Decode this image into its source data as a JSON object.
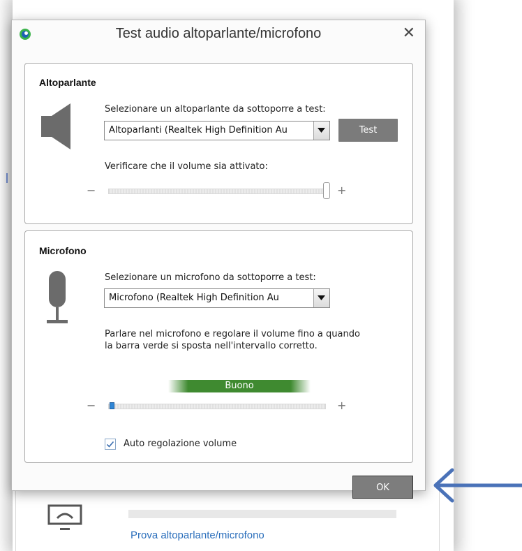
{
  "dialog": {
    "title": "Test audio altoparlante/microfono",
    "close_glyph": "✕",
    "ok_label": "OK"
  },
  "speaker": {
    "group_title": "Altoparlante",
    "select_prompt": "Selezionare un altoparlante da sottoporre a test:",
    "selected_device": "Altoparlanti (Realtek High Definition Au",
    "test_label": "Test",
    "volume_prompt": "Verificare che il volume sia attivato:",
    "minus": "−",
    "plus": "+",
    "volume_level": 1.0,
    "icon": "speaker-icon"
  },
  "microphone": {
    "group_title": "Microfono",
    "select_prompt": "Selezionare un microfono da sottoporre a test:",
    "selected_device": "Microfono (Realtek High Definition Au",
    "instructions_line1": "Parlare nel microfono e regolare il volume fino a quando",
    "instructions_line2": "la barra verde si sposta nell'intervallo corretto.",
    "meter_label": "Buono",
    "minus": "−",
    "plus": "+",
    "volume_level": 0.0,
    "auto_adjust_label": "Auto regolazione volume",
    "auto_adjust_checked": true,
    "icon": "microphone-icon"
  },
  "background": {
    "link_text": "Prova altoparlante/microfono"
  },
  "colors": {
    "meter_green": "#3f8a30",
    "button_gray": "#7b7b7b",
    "arrow_blue": "#4a72b8",
    "link_blue": "#2a6ebb"
  }
}
